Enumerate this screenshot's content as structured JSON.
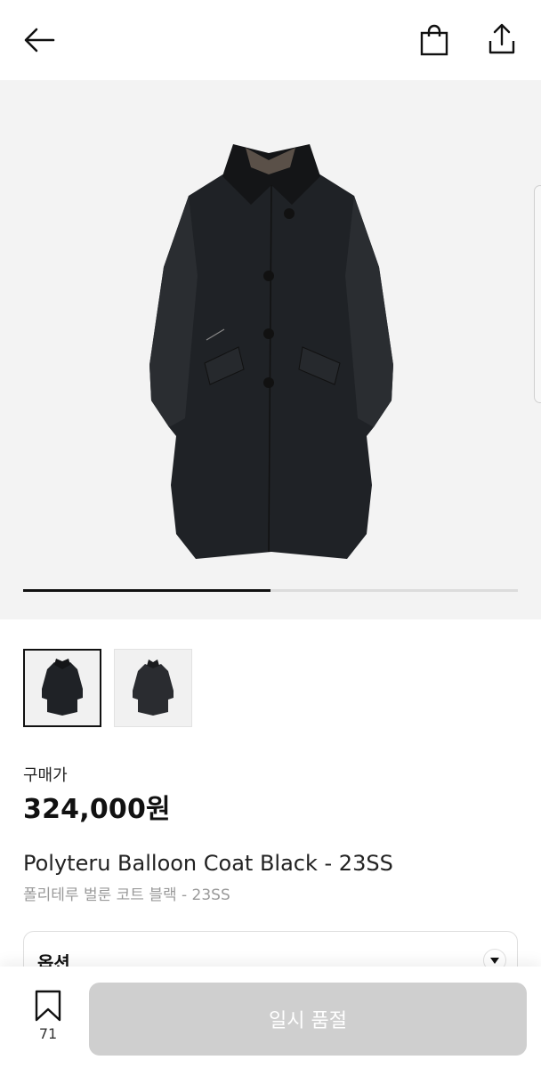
{
  "header": {
    "back_icon": "arrow-left-icon",
    "bag_icon": "shopping-bag-icon",
    "share_icon": "share-upload-icon"
  },
  "gallery": {
    "progress_fraction": 0.5,
    "thumbnails": [
      {
        "active": true
      },
      {
        "active": false
      }
    ]
  },
  "product": {
    "price_label": "구매가",
    "price": "324,000원",
    "name_en": "Polyteru Balloon Coat Black - 23SS",
    "name_ko": "폴리테루 벌룬 코트 블랙 - 23SS"
  },
  "option": {
    "label": "옵션",
    "caret_icon": "chevron-down-icon"
  },
  "bottom_bar": {
    "wishlist_icon": "bookmark-icon",
    "wishlist_count": "71",
    "cta_label": "일시 품절"
  },
  "colors": {
    "accent": "#111111",
    "disabled_button": "#cfcfcf",
    "background_gallery": "#f3f3f3"
  }
}
